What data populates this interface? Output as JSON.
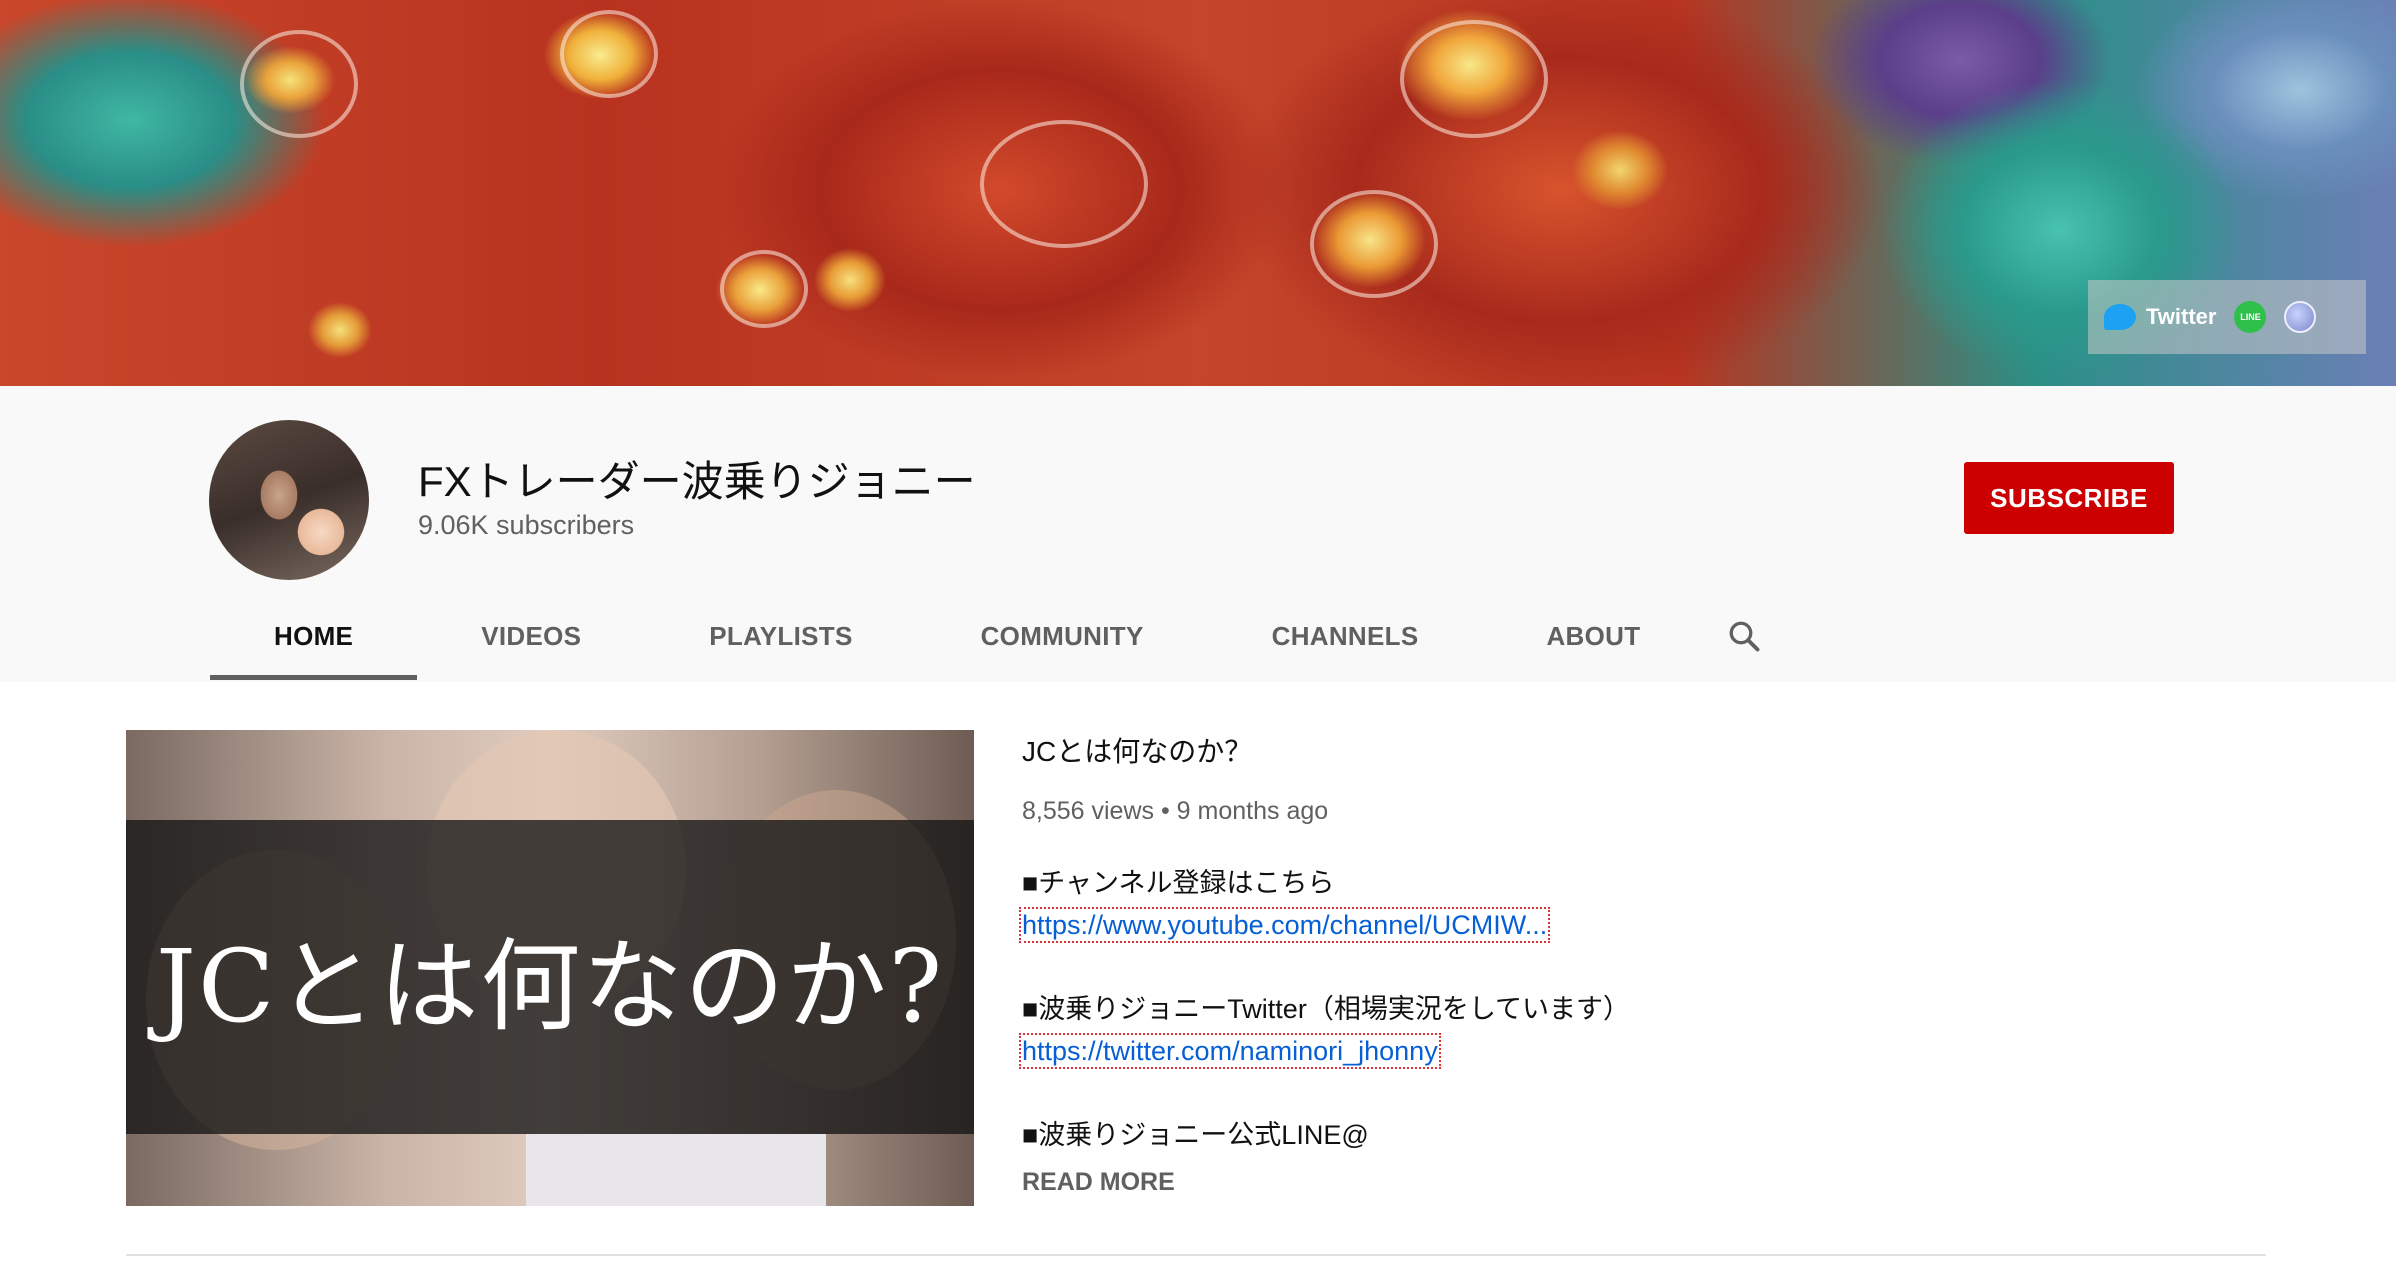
{
  "banner": {
    "social": {
      "twitter_label": "Twitter",
      "line_label": "LINE"
    }
  },
  "channel": {
    "name": "FXトレーダー波乗りジョニー",
    "subscribers": "9.06K subscribers",
    "subscribe_label": "SUBSCRIBE"
  },
  "tabs": [
    {
      "label": "HOME",
      "active": true
    },
    {
      "label": "VIDEOS"
    },
    {
      "label": "PLAYLISTS"
    },
    {
      "label": "COMMUNITY"
    },
    {
      "label": "CHANNELS"
    },
    {
      "label": "ABOUT"
    }
  ],
  "featured": {
    "thumbnail_text": "JCとは何なのか?",
    "title": "JCとは何なのか？",
    "meta": "8,556 views • 9 months ago",
    "description": {
      "line1": "■チャンネル登録はこちら",
      "link1": "https://www.youtube.com/channel/UCMIW...",
      "line2": "■波乗りジョニーTwitter（相場実況をしています）",
      "link2": "https://twitter.com/naminori_jhonny",
      "line3": "■波乗りジョニー公式LINE@"
    },
    "read_more": "READ MORE"
  },
  "colors": {
    "subscribe": "#cc0000",
    "link": "#065fd4"
  }
}
